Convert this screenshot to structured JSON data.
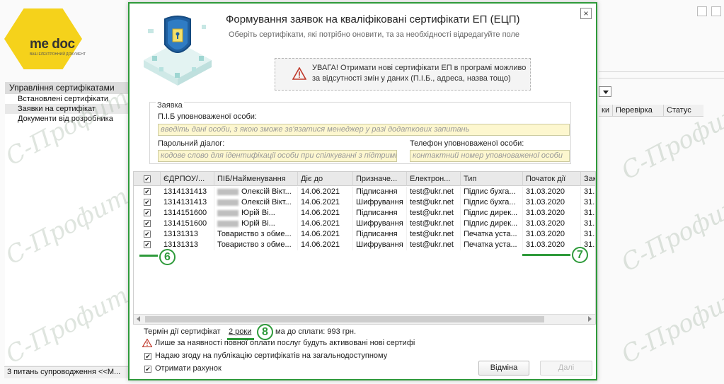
{
  "app": {
    "logo_text": "me doc",
    "logo_sub": "ВАШ ЕЛЕКТРОННИЙ ДОКУМЕНТ",
    "sidebar": {
      "title": "Управління сертифікатами",
      "items": [
        {
          "label": "Встановлені сертифікати"
        },
        {
          "label": "Заявки на сертифікат"
        },
        {
          "label": "Документи від розробника"
        }
      ]
    },
    "right_columns": [
      "ки",
      "Перевірка",
      "Статус"
    ],
    "status_bar": "3 питань супроводження <<M..."
  },
  "watermark": "С-Профит",
  "dialog": {
    "title": "Формування заявок на кваліфіковані сертифікати ЕП (ЕЦП)",
    "subtitle": "Оберіть сертифікати, які потрібно оновити, та за необхідності відредагуйте поле",
    "close": "×",
    "warning": "УВАГА! Отримати нові сертифікати ЕП в програмі можливо     за відсутності змін у даних (П.І.Б., адреса, назва тощо)",
    "request": {
      "title": "Заявка",
      "person_label": "П.І.Б уповноваженої особи:",
      "person_placeholder": "введіть дані особи, з якою зможе зв'язатися менеджер у разі додаткових запитань",
      "password_label": "Парольний діалог:",
      "password_placeholder": "кодове слово для ідентифікації особи при спілкуванні з підтримкою",
      "phone_label": "Телефон уповноваженої особи:",
      "phone_placeholder": "контактний номер уповноваженої особи"
    },
    "table": {
      "columns": [
        "",
        "ЄДРПОУ/...",
        "ПІБ/Найменування",
        "Діє до",
        "Призначе...",
        "Електрон...",
        "Тип",
        "Початок дії",
        "Зак"
      ],
      "rows": [
        {
          "checked": "✔",
          "code": "1314131413",
          "blur": true,
          "name": "Олексій Вікт...",
          "valid": "14.06.2021",
          "purpose": "Підписання",
          "email": "test@ukr.net",
          "type": "Підпис бухга...",
          "start": "31.03.2020",
          "end": "31."
        },
        {
          "checked": "✔",
          "code": "1314131413",
          "blur": true,
          "name": "Олексій Вікт...",
          "valid": "14.06.2021",
          "purpose": "Шифрування",
          "email": "test@ukr.net",
          "type": "Підпис бухга...",
          "start": "31.03.2020",
          "end": "31."
        },
        {
          "checked": "✔",
          "code": "1314151600",
          "blur": true,
          "name": "Юрій Ві...",
          "valid": "14.06.2021",
          "purpose": "Підписання",
          "email": "test@ukr.net",
          "type": "Підпис дирек...",
          "start": "31.03.2020",
          "end": "31."
        },
        {
          "checked": "✔",
          "code": "1314151600",
          "blur": true,
          "name": "Юрій Ві...",
          "valid": "14.06.2021",
          "purpose": "Шифрування",
          "email": "test@ukr.net",
          "type": "Підпис дирек...",
          "start": "31.03.2020",
          "end": "31."
        },
        {
          "checked": "✔",
          "code": "13131313",
          "blur": false,
          "name": "Товариство з обме...",
          "valid": "14.06.2021",
          "purpose": "Підписання",
          "email": "test@ukr.net",
          "type": "Печатка уста...",
          "start": "31.03.2020",
          "end": "31."
        },
        {
          "checked": "✔",
          "code": "13131313",
          "blur": false,
          "name": "Товариство з обме...",
          "valid": "14.06.2021",
          "purpose": "Шифрування",
          "email": "test@ukr.net",
          "type": "Печатка уста...",
          "start": "31.03.2020",
          "end": "31."
        }
      ]
    },
    "markers": {
      "six": "6",
      "seven": "7",
      "eight": "8"
    },
    "footer": {
      "term_label": "Термін дії сертифікат",
      "term_value": "2 роки",
      "sum_text": "ма до сплати: 993 грн.",
      "warn_text": "Лише за наявності повної оплати послуг будуть активовані нові сертифі",
      "consent_label": "Надаю згоду на публікацію сертифікатів на загальнодоступному",
      "invoice_label": "Отримати рахунок",
      "checked": "✔",
      "cancel_label": "Відміна",
      "next_label": "Далі"
    }
  }
}
